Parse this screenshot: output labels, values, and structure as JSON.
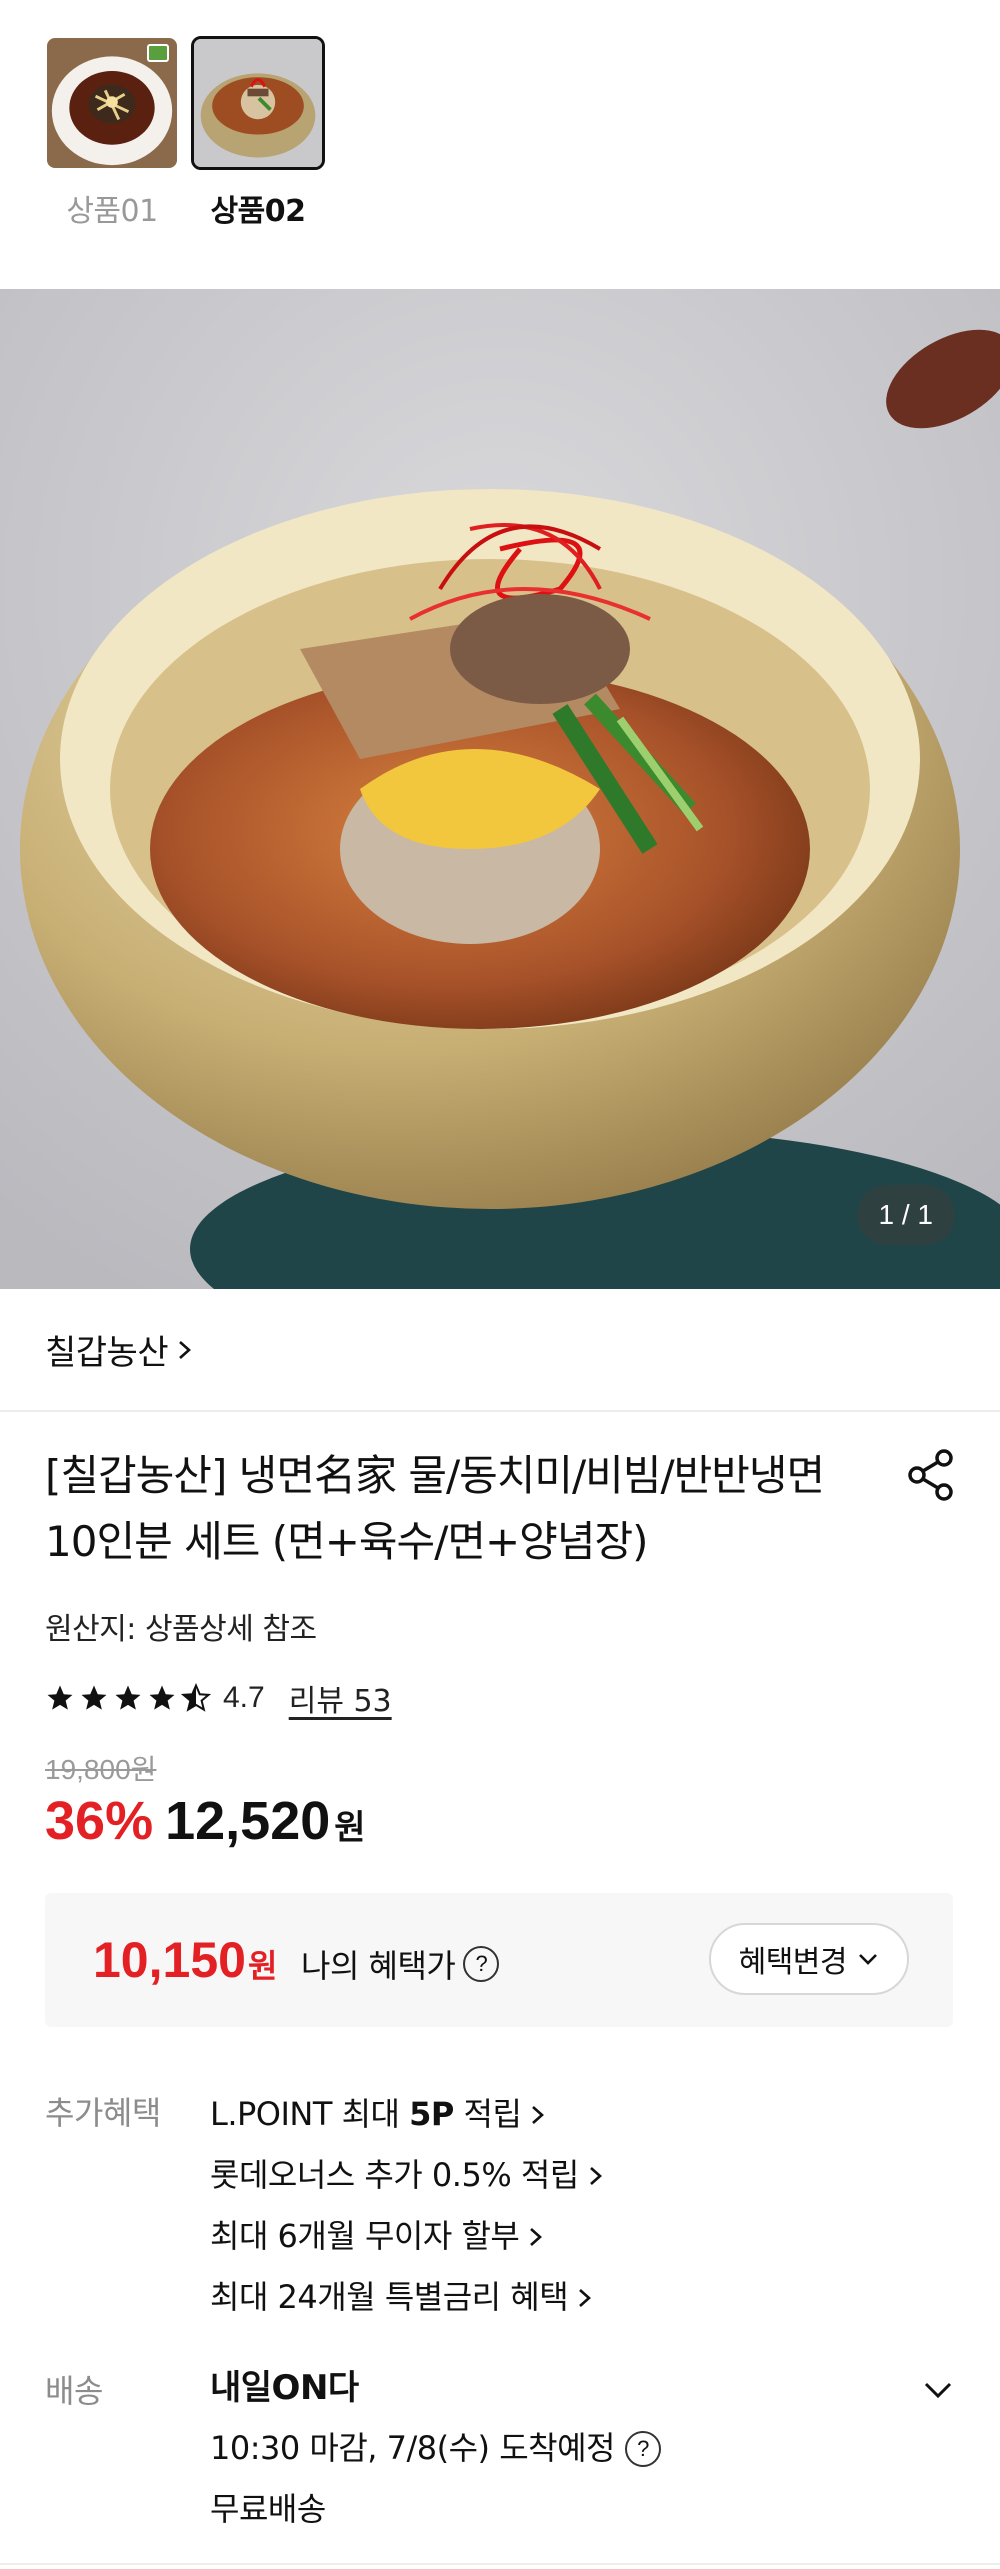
{
  "options": [
    {
      "label": "상품01",
      "selected": false
    },
    {
      "label": "상품02",
      "selected": true
    }
  ],
  "gallery": {
    "counter": "1 / 1"
  },
  "seller": {
    "name": "칠갑농산",
    "chevron": "chevron-right-icon"
  },
  "product": {
    "title": "[칠갑농산] 냉면名家 물/동치미/비빔/반반냉면 10인분 세트 (면+육수/면+양념장)",
    "origin": "원산지: 상품상세 참조",
    "rating": "4.7",
    "rating_fraction": 0.94,
    "review_text": "리뷰 53",
    "original_price": "19,800원",
    "discount": "36%",
    "price": "12,520",
    "price_unit": "원"
  },
  "benefit": {
    "price": "10,150",
    "unit": "원",
    "label": "나의 혜택가",
    "help_icon": "question-icon",
    "change_button": "혜택변경"
  },
  "extra": {
    "label": "추가혜택",
    "items": [
      {
        "prefix": "L.POINT 최대 ",
        "bold": "5P",
        "suffix": " 적립"
      },
      {
        "prefix": "롯데오너스 추가 0.5% 적립",
        "bold": "",
        "suffix": ""
      },
      {
        "prefix": "최대 6개월 무이자 할부",
        "bold": "",
        "suffix": ""
      },
      {
        "prefix": "최대 24개월 특별금리 혜택",
        "bold": "",
        "suffix": ""
      }
    ]
  },
  "shipping": {
    "label": "배송",
    "title": "내일ON다",
    "arrival": "10:30 마감, 7/8(수) 도착예정",
    "fee": "무료배송"
  },
  "colors": {
    "accent_red": "#e32124",
    "muted": "#8c8c8c"
  }
}
